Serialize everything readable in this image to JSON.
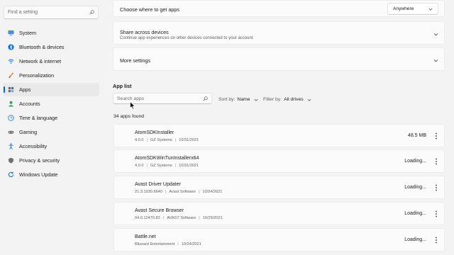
{
  "sidebar": {
    "search_placeholder": "Find a setting",
    "items": [
      {
        "label": "System",
        "icon": "monitor-icon",
        "color": "#4a8fd8"
      },
      {
        "label": "Bluetooth & devices",
        "icon": "bluetooth-icon",
        "color": "#0a6cd8"
      },
      {
        "label": "Network & internet",
        "icon": "wifi-icon",
        "color": "#2a7fd6"
      },
      {
        "label": "Personalization",
        "icon": "brush-icon",
        "color": "#d6843a"
      },
      {
        "label": "Apps",
        "icon": "apps-icon",
        "color": "#5a6a80",
        "active": true
      },
      {
        "label": "Accounts",
        "icon": "person-icon",
        "color": "#2f9f6a"
      },
      {
        "label": "Time & language",
        "icon": "globe-clock-icon",
        "color": "#2f7fd0"
      },
      {
        "label": "Gaming",
        "icon": "gamepad-icon",
        "color": "#6b6b6b"
      },
      {
        "label": "Accessibility",
        "icon": "accessibility-icon",
        "color": "#1a76d2"
      },
      {
        "label": "Privacy & security",
        "icon": "shield-icon",
        "color": "#707070"
      },
      {
        "label": "Windows Update",
        "icon": "update-icon",
        "color": "#1a76d2"
      }
    ]
  },
  "main": {
    "get_apps": {
      "label": "Choose where to get apps",
      "value": "Anywhere"
    },
    "share": {
      "title": "Share across devices",
      "subtitle": "Continue app experiences on other devices connected to your account"
    },
    "more_settings": {
      "label": "More settings"
    },
    "app_list": {
      "title": "App list",
      "search_placeholder": "Search apps",
      "sort_label": "Sort by:",
      "sort_value": "Name",
      "filter_label": "Filter by:",
      "filter_value": "All drives",
      "count": "34 apps found",
      "apps": [
        {
          "name": "AtomSDKInstaller",
          "version": "4.0.0",
          "publisher": "GZ Systems",
          "date": "10/31/2021",
          "size": "48.5 MB"
        },
        {
          "name": "AtomSDKWinTunInstallerx64",
          "version": "4.0.0",
          "publisher": "GZ Systems",
          "date": "10/31/2021",
          "size": "Loading..."
        },
        {
          "name": "Avast Driver Updater",
          "version": "21.3.1930.6640",
          "publisher": "Avast Software",
          "date": "10/24/2021",
          "size": "Loading..."
        },
        {
          "name": "Avast Secure Browser",
          "version": "94.0.12470.82",
          "publisher": "AVAST Software",
          "date": "10/29/2021",
          "size": "Loading..."
        },
        {
          "name": "Battle.net",
          "version": "",
          "publisher": "Blizzard Entertainment",
          "date": "10/24/2021",
          "size": "Loading..."
        }
      ]
    }
  },
  "colors": {
    "accent": "#0067c0",
    "background": "#f3f3f3",
    "card": "#fbfbfb"
  }
}
